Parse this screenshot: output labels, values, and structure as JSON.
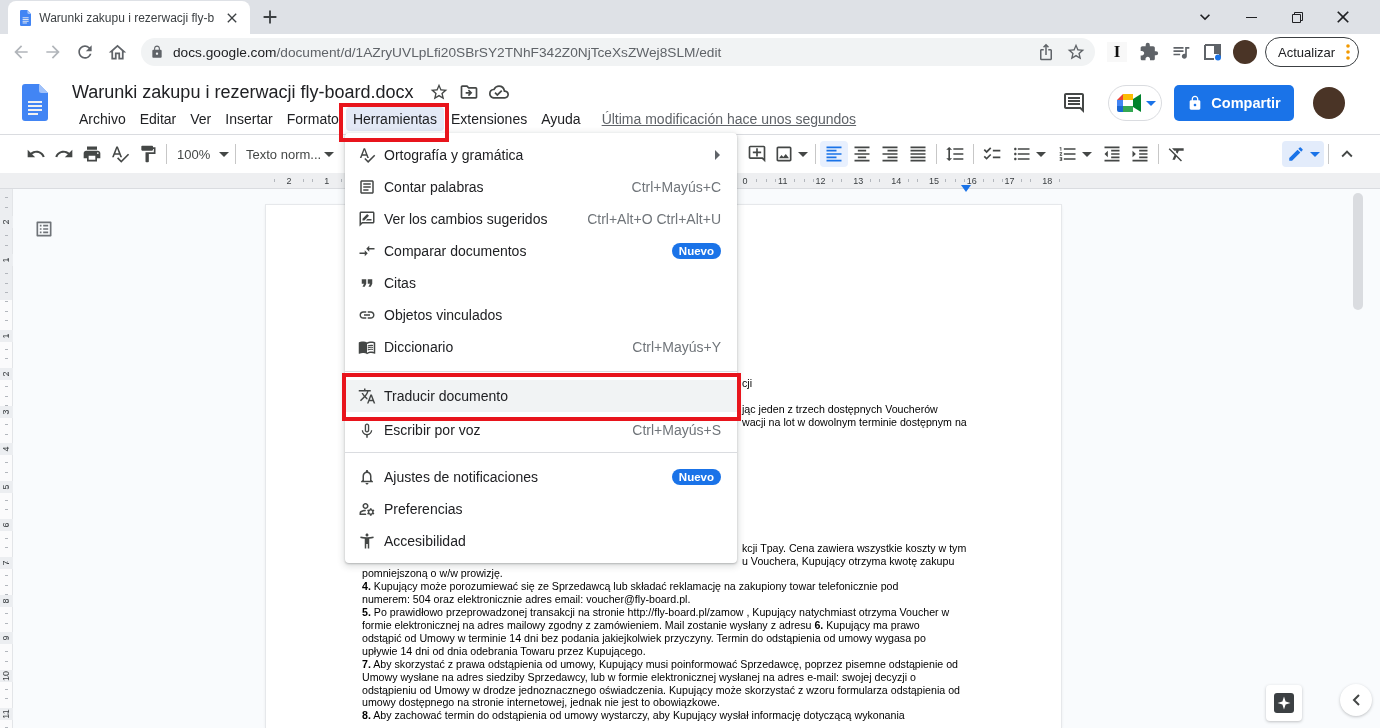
{
  "browser": {
    "tab_title": "Warunki zakupu i rezerwacji fly-b",
    "back": {
      "disabled": true
    },
    "forward": {
      "disabled": true
    },
    "url_host": "docs.google.com",
    "url_path": "/document/d/1AZryUVLpLfi20SBrSY2TNhF342Z0NjTceXsZWej8SLM/edit",
    "extension_label": "I",
    "update_button": "Actualizar"
  },
  "docs": {
    "title": "Warunki zakupu i rezerwacji fly-board.docx",
    "menus": [
      {
        "label": "Archivo",
        "selected": false,
        "annotated": false
      },
      {
        "label": "Editar",
        "selected": false,
        "annotated": false
      },
      {
        "label": "Ver",
        "selected": false,
        "annotated": false
      },
      {
        "label": "Insertar",
        "selected": false,
        "annotated": false
      },
      {
        "label": "Formato",
        "selected": false,
        "annotated": false
      },
      {
        "label": "Herramientas",
        "selected": true,
        "annotated": true
      },
      {
        "label": "Extensiones",
        "selected": false,
        "annotated": false
      },
      {
        "label": "Ayuda",
        "selected": false,
        "annotated": false
      }
    ],
    "last_edit": "Última modificación hace unos segundos",
    "share_button": "Compartir"
  },
  "toolbar": {
    "zoom": "100%",
    "text_style": "Texto norm...",
    "align": [
      {
        "kind": "left",
        "selected": true
      },
      {
        "kind": "center",
        "selected": false
      },
      {
        "kind": "right",
        "selected": false
      },
      {
        "kind": "justify",
        "selected": false
      }
    ]
  },
  "ruler": {
    "left_labels": [
      "2",
      "1"
    ],
    "right_labels": [
      "0",
      "11",
      "12",
      "13",
      "14",
      "15",
      "16",
      "17",
      "18"
    ]
  },
  "vertical_ruler": {
    "top_labels": [
      "2",
      "1"
    ],
    "labels": [
      "1",
      "2",
      "3",
      "4",
      "5",
      "6",
      "7",
      "8",
      "9",
      "10",
      "11"
    ]
  },
  "menu": {
    "groups": [
      {
        "items": [
          {
            "kind": "spelling",
            "label": "Ortografía y gramática",
            "submenu": true,
            "highlighted": false,
            "annotated": false
          },
          {
            "kind": "wordcount",
            "label": "Contar palabras",
            "shortcut": "Ctrl+Mayús+C",
            "submenu": false,
            "highlighted": false,
            "annotated": false
          },
          {
            "kind": "suggestions",
            "label": "Ver los cambios sugeridos",
            "shortcut": "Ctrl+Alt+O Ctrl+Alt+U",
            "submenu": false,
            "highlighted": false,
            "annotated": false
          },
          {
            "kind": "compare",
            "label": "Comparar documentos",
            "badge": "Nuevo",
            "submenu": false,
            "highlighted": false,
            "annotated": false
          },
          {
            "kind": "citations",
            "label": "Citas",
            "submenu": false,
            "highlighted": false,
            "annotated": false
          },
          {
            "kind": "links",
            "label": "Objetos vinculados",
            "submenu": false,
            "highlighted": false,
            "annotated": false
          },
          {
            "kind": "dictionary",
            "label": "Diccionario",
            "shortcut": "Ctrl+Mayús+Y",
            "submenu": false,
            "highlighted": false,
            "annotated": false
          }
        ]
      },
      {
        "items": [
          {
            "kind": "translate",
            "label": "Traducir documento",
            "submenu": false,
            "highlighted": true,
            "annotated": true
          },
          {
            "kind": "voice",
            "label": "Escribir por voz",
            "shortcut": "Ctrl+Mayús+S",
            "submenu": false,
            "highlighted": false,
            "annotated": false
          }
        ]
      },
      {
        "items": [
          {
            "kind": "notifications",
            "label": "Ajustes de notificaciones",
            "badge": "Nuevo",
            "submenu": false,
            "highlighted": false,
            "annotated": false
          },
          {
            "kind": "preferences",
            "label": "Preferencias",
            "submenu": false,
            "highlighted": false,
            "annotated": false
          },
          {
            "kind": "accessibility",
            "label": "Accesibilidad",
            "submenu": false,
            "highlighted": false,
            "annotated": false
          }
        ]
      }
    ]
  },
  "document": {
    "fragments": [
      {
        "lines": [
          "cji"
        ]
      },
      {
        "lines": [
          "jąc jeden z trzech dostępnych Voucherów",
          "wacji na lot w dowolnym terminie dostępnym na"
        ]
      },
      {
        "lines": [
          "kcji Tpay. Cena zawiera wszystkie koszty w tym",
          "u Vouchera, Kupujący otrzyma kwotę zakupu"
        ]
      }
    ],
    "paragraphs": [
      {
        "lines": [
          "pomniejszoną o w/w prowizję."
        ]
      },
      {
        "lines": [
          "**4.** Kupujący może porozumiewać się ze Sprzedawcą lub składać reklamację na zakupiony towar telefonicznie pod",
          "numerem: 504 oraz elektronicznie adres email: voucher@fly-board.pl."
        ]
      },
      {
        "lines": [
          "**5.** Po prawidłowo przeprowadzonej transakcji na stronie http://fly-board.pl/zamow , Kupujący natychmiast otrzyma Voucher w",
          "formie elektronicznej na adres mailowy zgodny z zamówieniem. Mail zostanie wysłany z adresu **6.** Kupujący ma prawo",
          "odstąpić od Umowy w terminie 14 dni bez podania jakiejkolwiek przyczyny. Termin do odstąpienia od umowy wygasa po",
          "upływie 14 dni od dnia odebrania Towaru przez Kupującego."
        ]
      },
      {
        "lines": [
          "**7.** Aby skorzystać z prawa odstąpienia od umowy, Kupujący musi poinformować Sprzedawcę, poprzez pisemne odstąpienie od",
          "Umowy wysłane na adres siedziby Sprzedawcy, lub w formie elektronicznej wysłanej na adres e-mail: swojej decyzji o",
          "odstąpieniu od Umowy w drodze jednoznacznego oświadczenia. Kupujący może skorzystać z wzoru formularza odstąpienia od",
          "umowy dostępnego na stronie internetowej, jednak nie jest to obowiązkowe."
        ]
      },
      {
        "lines": [
          "**8.** Aby zachować termin do odstąpienia od umowy wystarczy, aby Kupujący wysłał informację dotyczącą wykonania"
        ]
      }
    ]
  }
}
